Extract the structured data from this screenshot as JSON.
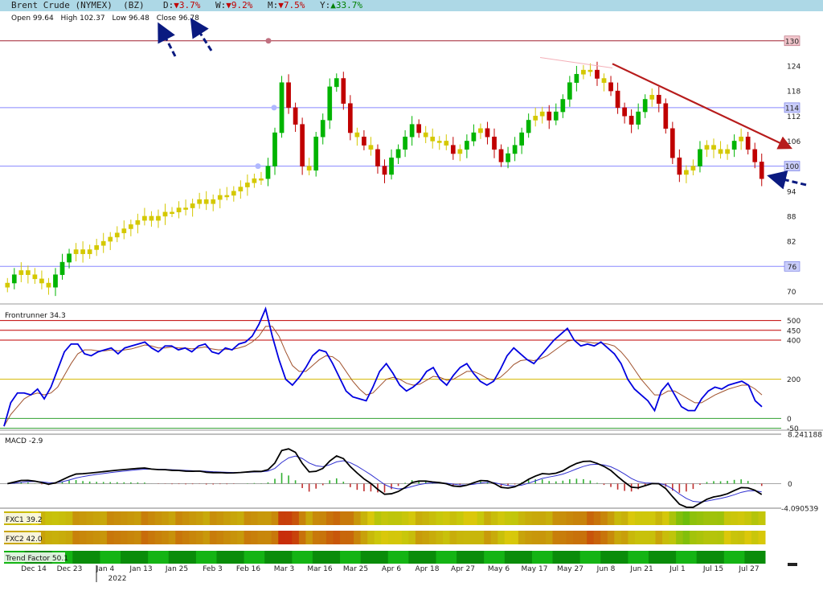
{
  "header": {
    "title": "Brent Crude (NYMEX)  (BZ)",
    "d_label": "D:",
    "d_arrow": "▼",
    "d_value": "3.7%",
    "w_label": "W:",
    "w_arrow": "▼",
    "w_value": "9.2%",
    "m_label": "M:",
    "m_arrow": "▼",
    "m_value": "7.5%",
    "y_label": "Y:",
    "y_arrow": "▲",
    "y_value": "33.7%"
  },
  "ohlc": {
    "open": "Open 99.64",
    "high": "High 102.37",
    "low": "Low 96.48",
    "close": "Close 96.78"
  },
  "colors": {
    "up": "#00b400",
    "down": "#c00000",
    "weak": "#d4c800",
    "rsi": "#0000e0",
    "signal": "#a0522d",
    "macd": "#000000"
  },
  "chart_data": [
    {
      "type": "candlestick",
      "title": "Brent Crude (NYMEX)  (BZ)",
      "y_ticks": [
        "70",
        "76",
        "82",
        "88",
        "94",
        "100",
        "106",
        "112",
        "118",
        "124",
        "130"
      ],
      "ylim": [
        67,
        134
      ],
      "level_labels": [
        "130",
        "114",
        "100",
        "76"
      ],
      "levels": [
        130,
        114,
        100,
        76
      ],
      "x_ticks": [
        "Dec 14",
        "Dec 23",
        "Jan 4",
        "Jan 13",
        "Jan 25",
        "Feb 3",
        "Feb 16",
        "Mar 3",
        "Mar 16",
        "Mar 25",
        "Apr 6",
        "Apr 18",
        "Apr 27",
        "May 6",
        "May 17",
        "May 27",
        "Jun 8",
        "Jun 21",
        "Jul 1",
        "Jul 15",
        "Jul 27"
      ],
      "year_label": "2022",
      "close_series": [
        72,
        74,
        75,
        74,
        73,
        72,
        71,
        74,
        77,
        79,
        80,
        79,
        80,
        81,
        82,
        83,
        84,
        85,
        86,
        87,
        88,
        87,
        88,
        89,
        89,
        90,
        90,
        91,
        92,
        91,
        92,
        93,
        93,
        94,
        95,
        96,
        97,
        97,
        100,
        108,
        120,
        114,
        110,
        100,
        99,
        107,
        111,
        119,
        121,
        115,
        108,
        107,
        105,
        104,
        100,
        98,
        102,
        104,
        107,
        110,
        108,
        107,
        106,
        106,
        105,
        103,
        104,
        106,
        108,
        109,
        107,
        104,
        101,
        103,
        105,
        108,
        111,
        112,
        113,
        111,
        113,
        116,
        120,
        122,
        123,
        123,
        121,
        120,
        118,
        114,
        112,
        110,
        113,
        116,
        117,
        115,
        109,
        102,
        98,
        99,
        100,
        104,
        105,
        104,
        103,
        104,
        106,
        107,
        104,
        101,
        97
      ],
      "annotations": [
        "trendline down from Jun 8 high",
        "arrow at Close 96.78"
      ]
    },
    {
      "type": "line",
      "title": "Frontrunner 34.3",
      "series": [
        {
          "name": "Frontrunner"
        },
        {
          "name": "Signal"
        }
      ],
      "y_ticks": [
        "500",
        "450",
        "400",
        "200",
        "0",
        "-50"
      ],
      "ylim": [
        -60,
        560
      ],
      "levels": [
        500,
        450,
        400,
        200,
        0,
        -50
      ],
      "values": [
        -40,
        80,
        130,
        130,
        120,
        150,
        100,
        160,
        250,
        340,
        380,
        380,
        330,
        320,
        340,
        350,
        360,
        330,
        360,
        370,
        380,
        390,
        360,
        340,
        370,
        370,
        350,
        360,
        340,
        370,
        380,
        340,
        330,
        360,
        350,
        380,
        390,
        420,
        480,
        560,
        420,
        300,
        200,
        170,
        210,
        260,
        320,
        350,
        340,
        280,
        210,
        140,
        110,
        100,
        90,
        160,
        240,
        280,
        230,
        170,
        140,
        160,
        190,
        240,
        260,
        200,
        170,
        220,
        260,
        280,
        230,
        190,
        170,
        190,
        250,
        320,
        360,
        330,
        300,
        280,
        320,
        360,
        400,
        430,
        460,
        400,
        370,
        380,
        370,
        390,
        360,
        330,
        280,
        200,
        150,
        120,
        90,
        40,
        140,
        180,
        120,
        60,
        40,
        40,
        100,
        140,
        160,
        150,
        170,
        180,
        190,
        170,
        90,
        60
      ],
      "signal": [
        -40,
        20,
        60,
        100,
        120,
        130,
        120,
        130,
        160,
        220,
        280,
        330,
        350,
        350,
        345,
        345,
        350,
        345,
        350,
        355,
        365,
        375,
        370,
        360,
        360,
        365,
        360,
        360,
        355,
        360,
        365,
        355,
        350,
        352,
        352,
        360,
        370,
        390,
        420,
        470,
        470,
        420,
        340,
        270,
        240,
        240,
        270,
        300,
        320,
        315,
        290,
        240,
        190,
        150,
        120,
        130,
        165,
        200,
        210,
        200,
        180,
        170,
        175,
        195,
        215,
        210,
        195,
        200,
        220,
        240,
        240,
        225,
        205,
        195,
        210,
        240,
        275,
        295,
        300,
        295,
        305,
        320,
        345,
        370,
        395,
        400,
        395,
        390,
        385,
        385,
        380,
        370,
        340,
        300,
        250,
        200,
        160,
        120,
        120,
        140,
        140,
        120,
        100,
        80,
        80,
        100,
        120,
        135,
        150,
        160,
        170,
        170,
        150,
        120
      ]
    },
    {
      "type": "line",
      "title": "MACD -2.9",
      "series": [
        {
          "name": "MACD"
        },
        {
          "name": "Signal"
        }
      ],
      "y_ticks": [
        "8.241188",
        "0",
        "-4.090539"
      ],
      "ylim": [
        -4.090539,
        8.241188
      ]
    },
    {
      "type": "heatmap",
      "rows": [
        "FXC1 39.2",
        "FXC2 42.0",
        "Trend Factor 50.1"
      ]
    }
  ]
}
